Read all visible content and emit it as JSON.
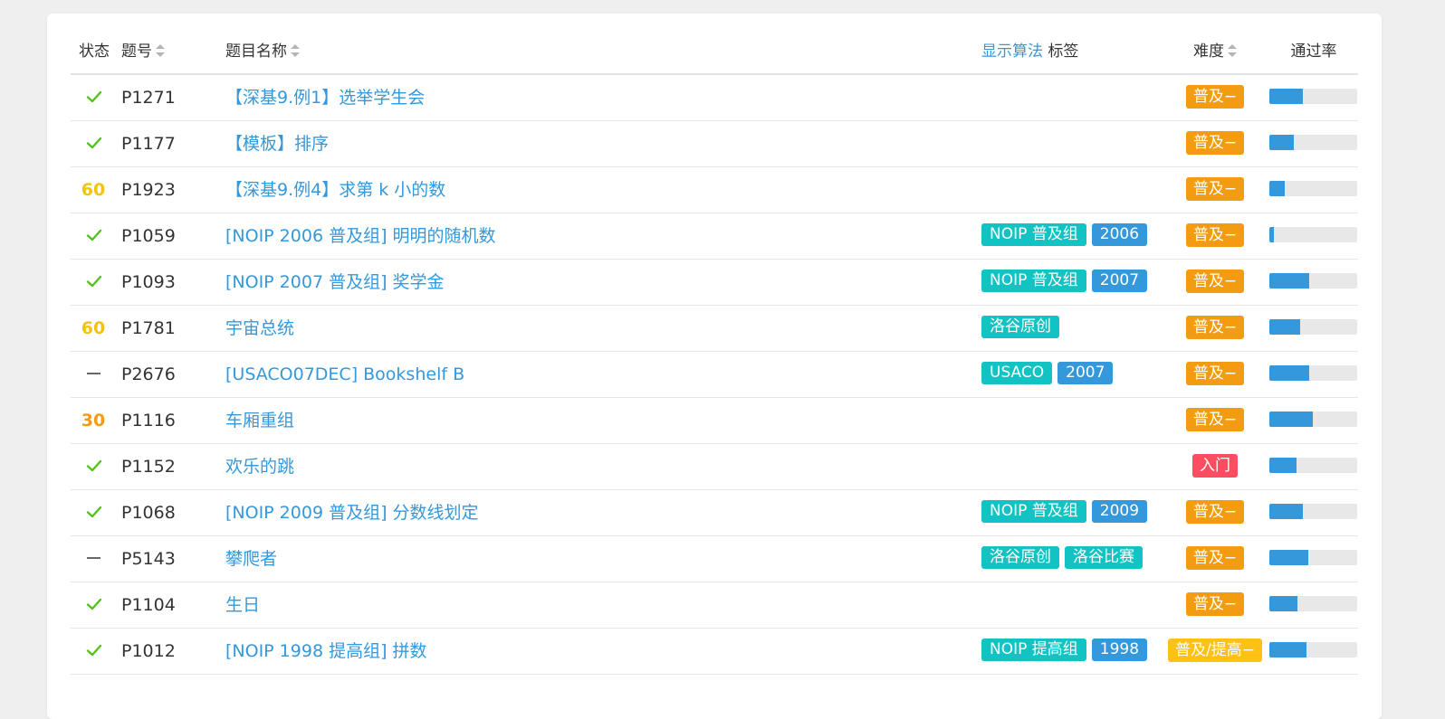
{
  "colors": {
    "link": "#3498db",
    "check": "#52c41a",
    "score_60": "#f1c40f",
    "score_30": "#f39c11",
    "tag_teal": "#13c2c2",
    "tag_blue": "#3498db",
    "diff_orange": "#f39c11",
    "diff_red": "#fe4c61",
    "diff_yellow": "#ffc116"
  },
  "header": {
    "status": "状态",
    "pid": "题号",
    "title": "题目名称",
    "show_algorithm": "显示算法",
    "tags": "标签",
    "difficulty": "难度",
    "pass_rate": "通过率"
  },
  "rows": [
    {
      "status_type": "check",
      "status_text": "",
      "pid": "P1271",
      "title": "【深基9.例1】选举学生会",
      "tags": [],
      "difficulty": "普及−",
      "diff_color": "#f39c11",
      "pass_rate": 0.38
    },
    {
      "status_type": "check",
      "status_text": "",
      "pid": "P1177",
      "title": "【模板】排序",
      "tags": [],
      "difficulty": "普及−",
      "diff_color": "#f39c11",
      "pass_rate": 0.28
    },
    {
      "status_type": "score",
      "status_text": "60",
      "score_color": "#f1c40f",
      "pid": "P1923",
      "title": "【深基9.例4】求第 k 小的数",
      "tags": [],
      "difficulty": "普及−",
      "diff_color": "#f39c11",
      "pass_rate": 0.18
    },
    {
      "status_type": "check",
      "status_text": "",
      "pid": "P1059",
      "title": "[NOIP 2006 普及组] 明明的随机数",
      "tags": [
        {
          "label": "NOIP 普及组",
          "color": "#13c2c2"
        },
        {
          "label": "2006",
          "color": "#3498db"
        }
      ],
      "difficulty": "普及−",
      "diff_color": "#f39c11",
      "pass_rate": 0.05
    },
    {
      "status_type": "check",
      "status_text": "",
      "pid": "P1093",
      "title": "[NOIP 2007 普及组] 奖学金",
      "tags": [
        {
          "label": "NOIP 普及组",
          "color": "#13c2c2"
        },
        {
          "label": "2007",
          "color": "#3498db"
        }
      ],
      "difficulty": "普及−",
      "diff_color": "#f39c11",
      "pass_rate": 0.45
    },
    {
      "status_type": "score",
      "status_text": "60",
      "score_color": "#f1c40f",
      "pid": "P1781",
      "title": "宇宙总统",
      "tags": [
        {
          "label": "洛谷原创",
          "color": "#13c2c2"
        }
      ],
      "difficulty": "普及−",
      "diff_color": "#f39c11",
      "pass_rate": 0.35
    },
    {
      "status_type": "dash",
      "status_text": "",
      "pid": "P2676",
      "title": "[USACO07DEC] Bookshelf B",
      "tags": [
        {
          "label": "USACO",
          "color": "#13c2c2"
        },
        {
          "label": "2007",
          "color": "#3498db"
        }
      ],
      "difficulty": "普及−",
      "diff_color": "#f39c11",
      "pass_rate": 0.45
    },
    {
      "status_type": "score",
      "status_text": "30",
      "score_color": "#f39c11",
      "pid": "P1116",
      "title": "车厢重组",
      "tags": [],
      "difficulty": "普及−",
      "diff_color": "#f39c11",
      "pass_rate": 0.49
    },
    {
      "status_type": "check",
      "status_text": "",
      "pid": "P1152",
      "title": "欢乐的跳",
      "tags": [],
      "difficulty": "入门",
      "diff_color": "#fe4c61",
      "pass_rate": 0.31
    },
    {
      "status_type": "check",
      "status_text": "",
      "pid": "P1068",
      "title": "[NOIP 2009 普及组] 分数线划定",
      "tags": [
        {
          "label": "NOIP 普及组",
          "color": "#13c2c2"
        },
        {
          "label": "2009",
          "color": "#3498db"
        }
      ],
      "difficulty": "普及−",
      "diff_color": "#f39c11",
      "pass_rate": 0.38
    },
    {
      "status_type": "dash",
      "status_text": "",
      "pid": "P5143",
      "title": "攀爬者",
      "tags": [
        {
          "label": "洛谷原创",
          "color": "#13c2c2"
        },
        {
          "label": "洛谷比赛",
          "color": "#13c2c2"
        }
      ],
      "difficulty": "普及−",
      "diff_color": "#f39c11",
      "pass_rate": 0.44
    },
    {
      "status_type": "check",
      "status_text": "",
      "pid": "P1104",
      "title": "生日",
      "tags": [],
      "difficulty": "普及−",
      "diff_color": "#f39c11",
      "pass_rate": 0.32
    },
    {
      "status_type": "check",
      "status_text": "",
      "pid": "P1012",
      "title": "[NOIP 1998 提高组] 拼数",
      "tags": [
        {
          "label": "NOIP 提高组",
          "color": "#13c2c2"
        },
        {
          "label": "1998",
          "color": "#3498db"
        }
      ],
      "difficulty": "普及/提高−",
      "diff_color": "#ffc116",
      "pass_rate": 0.42
    }
  ]
}
